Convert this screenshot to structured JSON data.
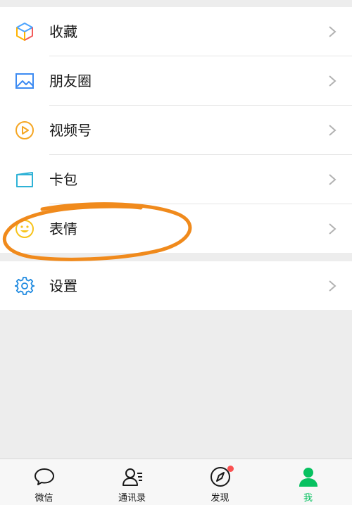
{
  "menu": {
    "items": [
      {
        "id": "favorites",
        "label": "收藏",
        "icon": "cube-icon"
      },
      {
        "id": "moments",
        "label": "朋友圈",
        "icon": "image-icon"
      },
      {
        "id": "channels",
        "label": "视频号",
        "icon": "play-circle-icon"
      },
      {
        "id": "cards",
        "label": "卡包",
        "icon": "card-wallet-icon"
      },
      {
        "id": "stickers",
        "label": "表情",
        "icon": "smiley-icon"
      }
    ],
    "settings": {
      "label": "设置",
      "icon": "gear-icon"
    }
  },
  "tabbar": {
    "tabs": [
      {
        "label": "微信",
        "icon": "chat-bubble-icon",
        "active": false
      },
      {
        "label": "通讯录",
        "icon": "contacts-icon",
        "active": false
      },
      {
        "label": "发现",
        "icon": "compass-icon",
        "active": false,
        "badge": true
      },
      {
        "label": "我",
        "icon": "person-icon",
        "active": true
      }
    ]
  },
  "colors": {
    "accent": "#07c160",
    "annotation": "#f08a1c",
    "badge": "#fa5151",
    "background": "#ededed"
  }
}
